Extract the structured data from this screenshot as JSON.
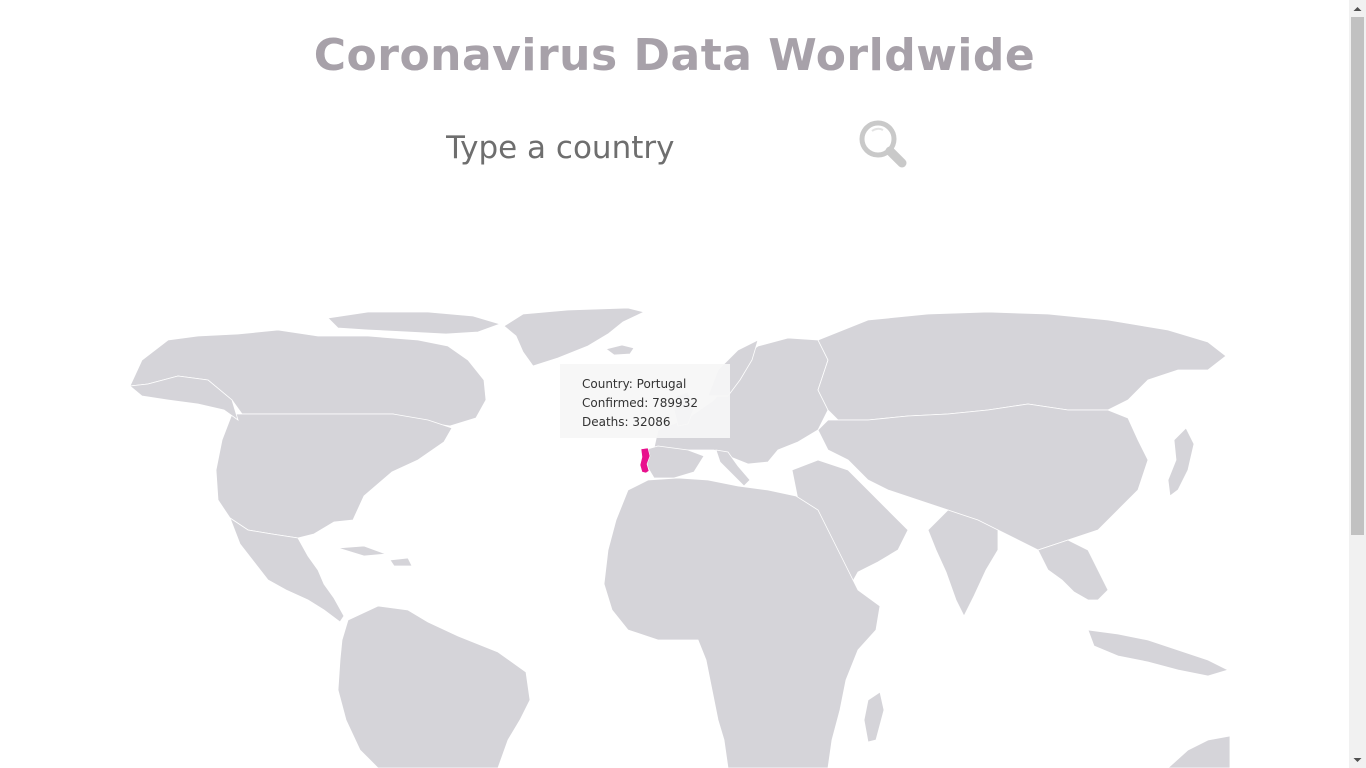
{
  "page": {
    "title": "Coronavirus Data Worldwide"
  },
  "search": {
    "placeholder": "Type a country",
    "value": "",
    "button_icon": "search-icon"
  },
  "map": {
    "default_fill": "#d5d4d9",
    "highlight_fill": "#e8118d",
    "selected_country": "Portugal"
  },
  "tooltip": {
    "country_line": "Country: Portugal",
    "confirmed_line": "Confirmed: 789932",
    "deaths_line": "Deaths: 32086"
  },
  "scrollbar": {
    "up_icon": "arrow-up-icon",
    "down_icon": "arrow-down-icon"
  }
}
